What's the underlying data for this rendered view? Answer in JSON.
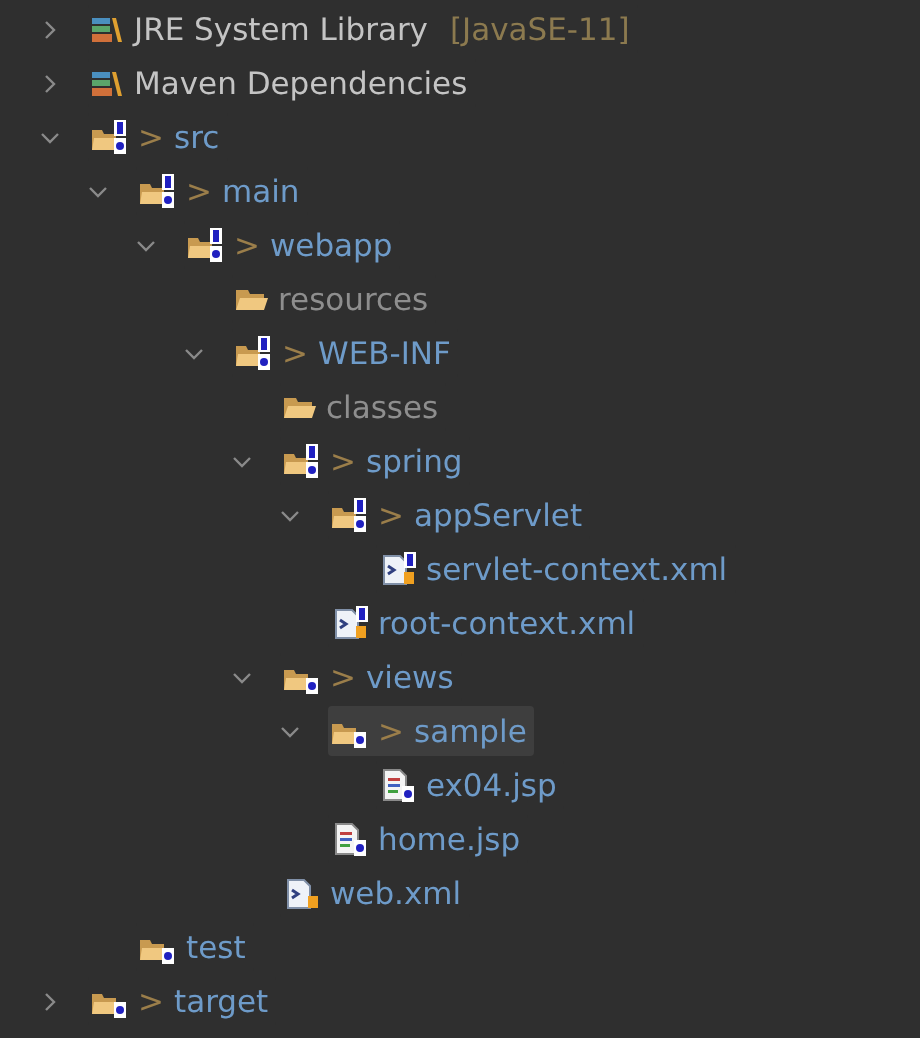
{
  "tree": [
    {
      "kind": "library",
      "label": "JRE System Library",
      "suffix": "[JavaSE-11]",
      "expanded": false,
      "selected": false
    },
    {
      "kind": "library",
      "label": "Maven Dependencies",
      "expanded": false,
      "selected": false
    },
    {
      "kind": "versioned-folder",
      "prefix": ">",
      "label": "src",
      "expanded": true,
      "selected": false,
      "children": [
        {
          "kind": "versioned-folder",
          "prefix": ">",
          "label": "main",
          "expanded": true,
          "selected": false,
          "children": [
            {
              "kind": "versioned-folder",
              "prefix": ">",
              "label": "webapp",
              "expanded": true,
              "selected": false,
              "children": [
                {
                  "kind": "ignored-folder",
                  "label": "resources",
                  "selected": false
                },
                {
                  "kind": "versioned-folder",
                  "prefix": ">",
                  "label": "WEB-INF",
                  "expanded": true,
                  "selected": false,
                  "children": [
                    {
                      "kind": "ignored-folder",
                      "label": "classes",
                      "selected": false
                    },
                    {
                      "kind": "versioned-folder",
                      "prefix": ">",
                      "label": "spring",
                      "expanded": true,
                      "selected": false,
                      "children": [
                        {
                          "kind": "versioned-folder",
                          "prefix": ">",
                          "label": "appServlet",
                          "expanded": true,
                          "selected": false,
                          "children": [
                            {
                              "kind": "xml-file",
                              "label": "servlet-context.xml",
                              "selected": false
                            }
                          ]
                        },
                        {
                          "kind": "xml-file",
                          "label": "root-context.xml",
                          "selected": false
                        }
                      ]
                    },
                    {
                      "kind": "new-folder",
                      "prefix": ">",
                      "label": "views",
                      "expanded": true,
                      "selected": false,
                      "children": [
                        {
                          "kind": "new-folder",
                          "prefix": ">",
                          "label": "sample",
                          "expanded": true,
                          "selected": true,
                          "children": [
                            {
                              "kind": "jsp-file",
                              "label": "ex04.jsp",
                              "selected": false
                            }
                          ]
                        },
                        {
                          "kind": "jsp-file",
                          "label": "home.jsp",
                          "selected": false
                        }
                      ]
                    },
                    {
                      "kind": "web-xml-file",
                      "label": "web.xml",
                      "selected": false
                    }
                  ]
                }
              ]
            }
          ]
        },
        {
          "kind": "new-folder",
          "label": "test",
          "selected": false
        }
      ]
    },
    {
      "kind": "new-folder",
      "prefix": ">",
      "label": "target",
      "expanded": false,
      "selected": false
    }
  ]
}
